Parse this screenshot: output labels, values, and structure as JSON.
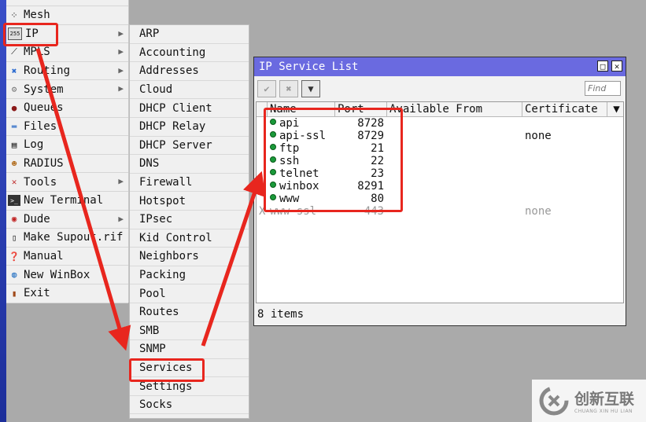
{
  "main_menu": {
    "items": [
      {
        "label": "",
        "icon": "partial-icon",
        "arrow": false
      },
      {
        "label": "Mesh",
        "icon": "mesh-icon",
        "arrow": false
      },
      {
        "label": "IP",
        "icon": "ip-icon",
        "arrow": true
      },
      {
        "label": "MPLS",
        "icon": "mpls-icon",
        "arrow": true
      },
      {
        "label": "Routing",
        "icon": "routing-icon",
        "arrow": true
      },
      {
        "label": "System",
        "icon": "gear-icon",
        "arrow": true
      },
      {
        "label": "Queues",
        "icon": "queues-icon",
        "arrow": false
      },
      {
        "label": "Files",
        "icon": "folder-icon",
        "arrow": false
      },
      {
        "label": "Log",
        "icon": "log-icon",
        "arrow": false
      },
      {
        "label": "RADIUS",
        "icon": "users-icon",
        "arrow": false
      },
      {
        "label": "Tools",
        "icon": "tools-icon",
        "arrow": true
      },
      {
        "label": "New Terminal",
        "icon": "terminal-icon",
        "arrow": false
      },
      {
        "label": "Dude",
        "icon": "dude-icon",
        "arrow": true
      },
      {
        "label": "Make Supout.rif",
        "icon": "file-icon",
        "arrow": false
      },
      {
        "label": "Manual",
        "icon": "help-icon",
        "arrow": false
      },
      {
        "label": "New WinBox",
        "icon": "winbox-icon",
        "arrow": false
      },
      {
        "label": "Exit",
        "icon": "exit-icon",
        "arrow": false
      }
    ]
  },
  "ip_submenu": {
    "items": [
      "ARP",
      "Accounting",
      "Addresses",
      "Cloud",
      "DHCP Client",
      "DHCP Relay",
      "DHCP Server",
      "DNS",
      "Firewall",
      "Hotspot",
      "IPsec",
      "Kid Control",
      "Neighbors",
      "Packing",
      "Pool",
      "Routes",
      "SMB",
      "SNMP",
      "Services",
      "Settings",
      "Socks"
    ]
  },
  "service_window": {
    "title": "IP Service List",
    "find_placeholder": "Find",
    "columns": [
      "Name",
      "Port",
      "Available From",
      "Certificate"
    ],
    "rows": [
      {
        "flag": "",
        "name": "api",
        "port": "8728",
        "from": "",
        "cert": "",
        "enabled": true
      },
      {
        "flag": "",
        "name": "api-ssl",
        "port": "8729",
        "from": "",
        "cert": "none",
        "enabled": true
      },
      {
        "flag": "",
        "name": "ftp",
        "port": "21",
        "from": "",
        "cert": "",
        "enabled": true
      },
      {
        "flag": "",
        "name": "ssh",
        "port": "22",
        "from": "",
        "cert": "",
        "enabled": true
      },
      {
        "flag": "",
        "name": "telnet",
        "port": "23",
        "from": "",
        "cert": "",
        "enabled": true
      },
      {
        "flag": "",
        "name": "winbox",
        "port": "8291",
        "from": "",
        "cert": "",
        "enabled": true
      },
      {
        "flag": "",
        "name": "www",
        "port": "80",
        "from": "",
        "cert": "",
        "enabled": true
      },
      {
        "flag": "X",
        "name": "www-ssl",
        "port": "443",
        "from": "",
        "cert": "none",
        "enabled": false
      }
    ],
    "status": "8 items"
  },
  "watermark": {
    "text": "创新互联",
    "subtext": "CHUANG XIN HU LIAN"
  },
  "colors": {
    "highlight": "#e8261e",
    "titlebar": "#6a6ae0",
    "status_dot": "#1a9a3a"
  }
}
